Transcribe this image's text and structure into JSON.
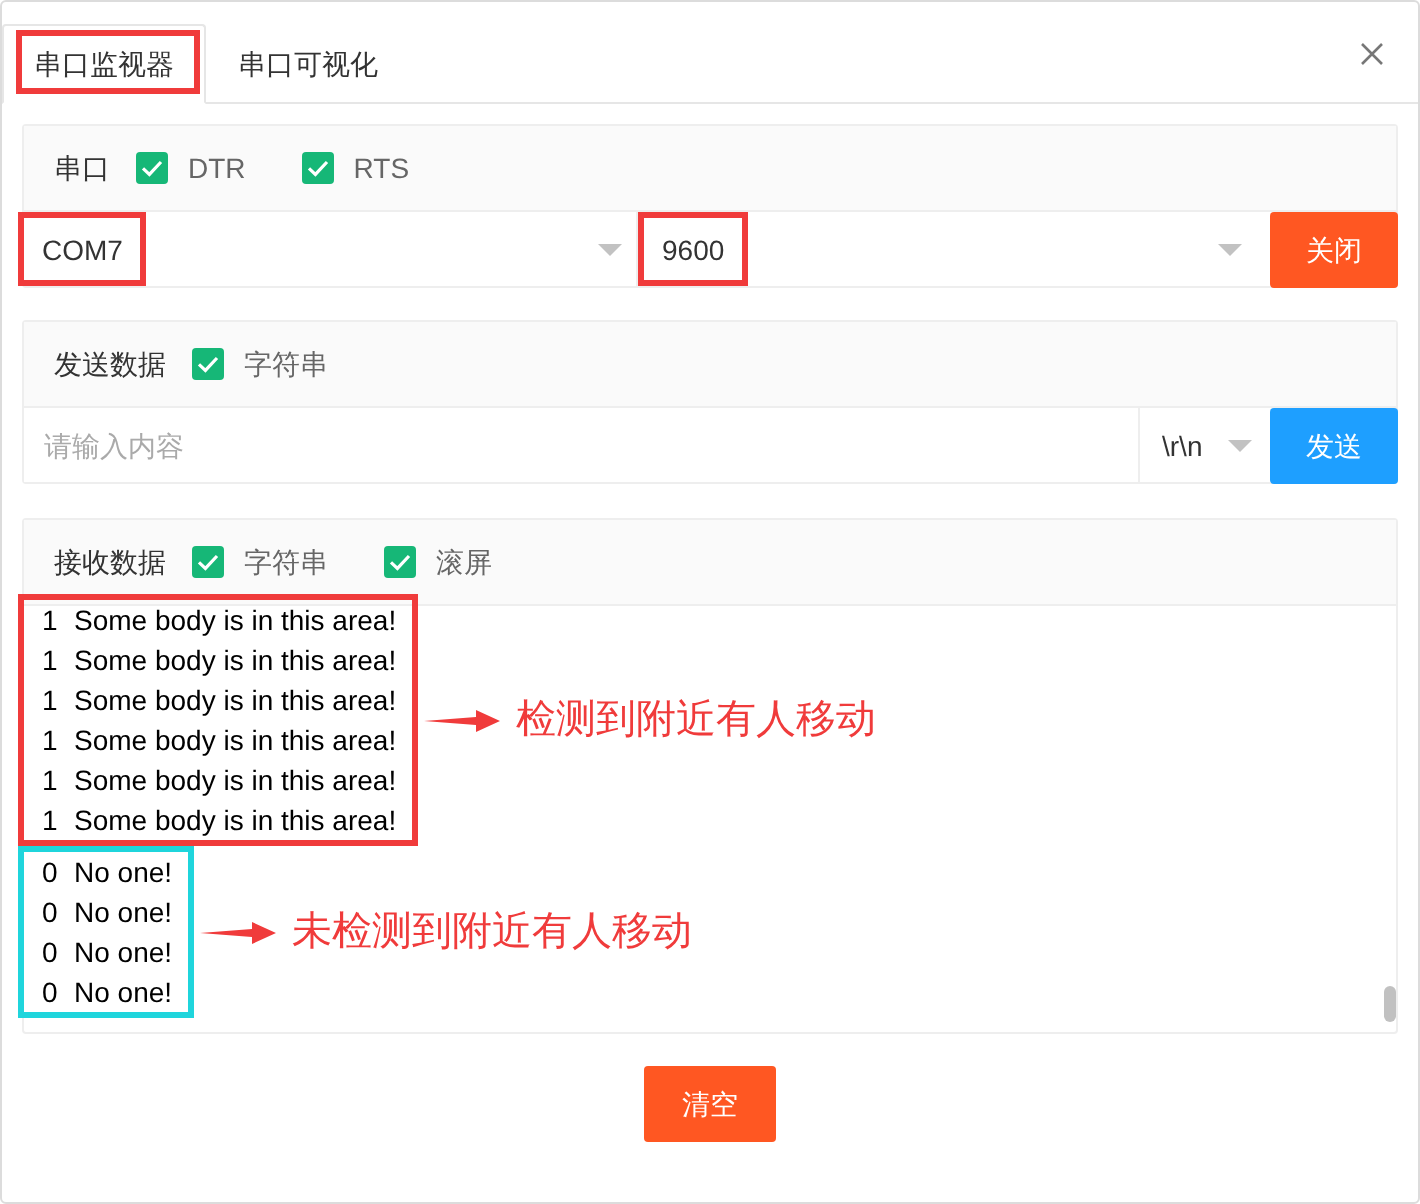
{
  "tabs": [
    {
      "label": "串口监视器",
      "selected": true,
      "highlighted": true
    },
    {
      "label": "串口可视化",
      "selected": false,
      "highlighted": false
    }
  ],
  "port_panel": {
    "title": "串口",
    "options": [
      {
        "label": "DTR",
        "checked": true
      },
      {
        "label": "RTS",
        "checked": true
      }
    ],
    "port_select": {
      "value": "COM7",
      "highlighted": true
    },
    "baud_select": {
      "value": "9600",
      "highlighted": true
    },
    "button": "关闭"
  },
  "send_panel": {
    "title": "发送数据",
    "options": [
      {
        "label": "字符串",
        "checked": true
      }
    ],
    "input": {
      "placeholder": "请输入内容"
    },
    "line_ending_select": {
      "value": "\\r\\n"
    },
    "button": "发送"
  },
  "receive_panel": {
    "title": "接收数据",
    "options": [
      {
        "label": "字符串",
        "checked": true
      },
      {
        "label": "滚屏",
        "checked": true
      }
    ],
    "groups": [
      {
        "color": "#f03b3b",
        "note": "检测到附近有人移动",
        "lines": [
          {
            "value": "1",
            "message": "Some body is in this area!"
          },
          {
            "value": "1",
            "message": "Some body is in this area!"
          },
          {
            "value": "1",
            "message": "Some body is in this area!"
          },
          {
            "value": "1",
            "message": "Some body is in this area!"
          },
          {
            "value": "1",
            "message": "Some body is in this area!"
          },
          {
            "value": "1",
            "message": "Some body is in this area!"
          }
        ]
      },
      {
        "color": "#1fd5dc",
        "note": "未检测到附近有人移动",
        "lines": [
          {
            "value": "0",
            "message": "No one!"
          },
          {
            "value": "0",
            "message": "No one!"
          },
          {
            "value": "0",
            "message": "No one!"
          },
          {
            "value": "0",
            "message": "No one!"
          }
        ]
      }
    ]
  },
  "clear_button": "清空"
}
